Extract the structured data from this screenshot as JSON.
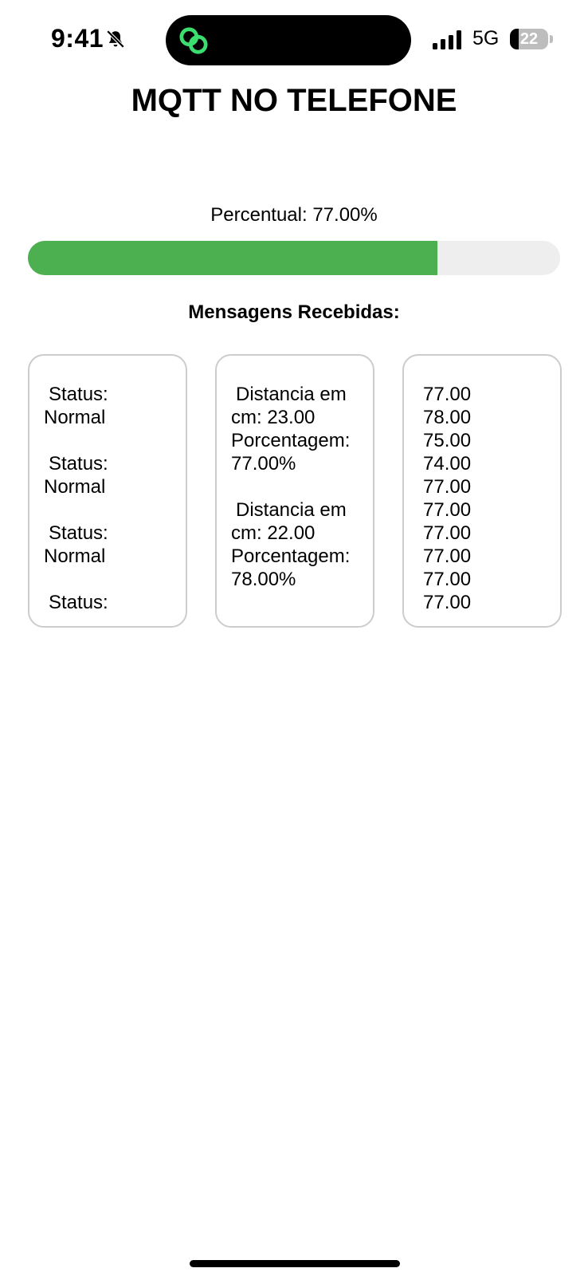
{
  "status_bar": {
    "time": "9:41",
    "network": "5G",
    "battery_level": "22",
    "battery_fraction": 0.22,
    "icons": [
      "bell-muted-icon",
      "link-icon",
      "signal-icon",
      "battery-icon"
    ]
  },
  "title": "MQTT NO TELEFONE",
  "progress": {
    "label": "Percentual: 77.00%",
    "value_percent": 77,
    "color": "#4caf50",
    "track_color": "#eeeeee"
  },
  "messages_heading": "Mensagens Recebidas:",
  "status_card": {
    "entries": [
      {
        "label": "Status:",
        "value": "Normal"
      },
      {
        "label": "Status:",
        "value": "Normal"
      },
      {
        "label": "Status:",
        "value": "Normal"
      },
      {
        "label": "Status:",
        "value": ""
      }
    ]
  },
  "distance_card": {
    "entries": [
      {
        "distance": "Distancia em cm: 23.00",
        "percent": "Porcentagem: 77.00%"
      },
      {
        "distance": "Distancia em cm: 22.00",
        "percent": "Porcentagem: 78.00%"
      }
    ]
  },
  "values_card": {
    "values": [
      "77.00",
      "78.00",
      "75.00",
      "74.00",
      "77.00",
      "77.00",
      "77.00",
      "77.00",
      "77.00",
      "77.00"
    ]
  }
}
